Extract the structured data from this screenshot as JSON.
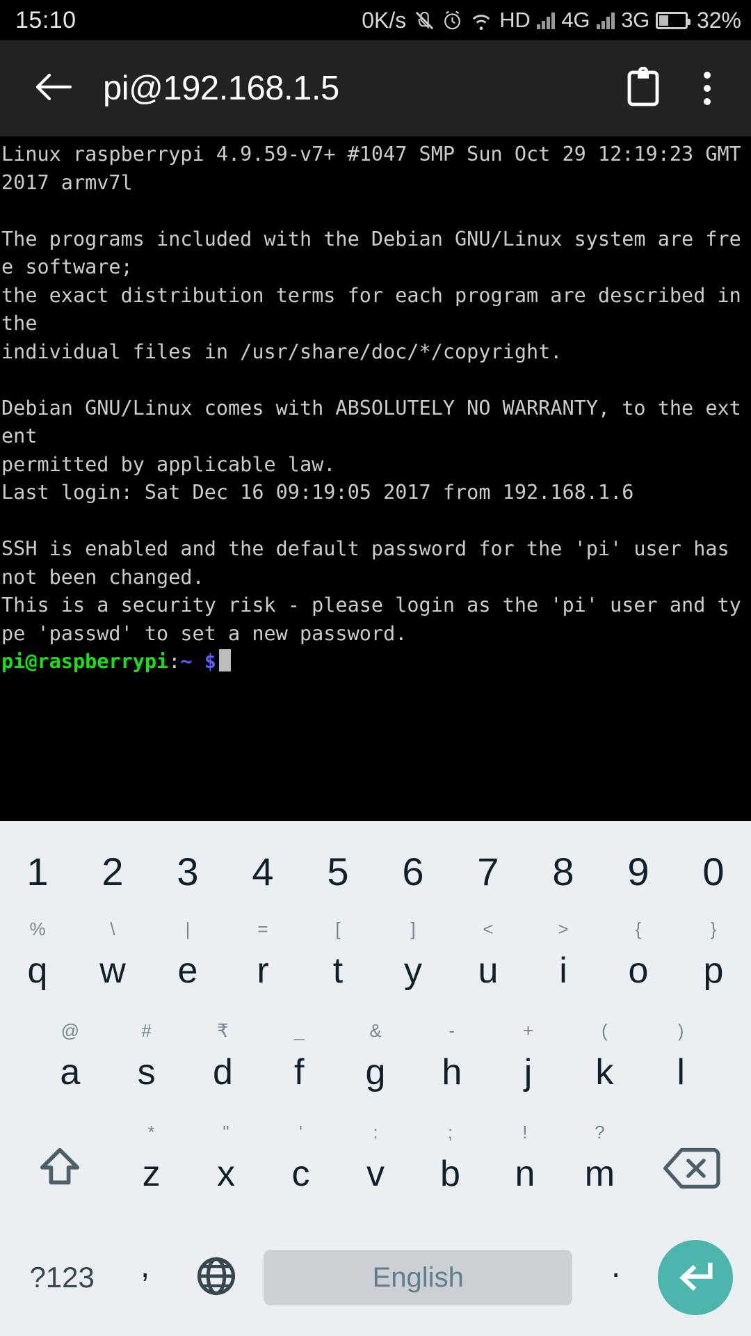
{
  "statusbar": {
    "clock": "15:10",
    "net_speed": "0K/s",
    "icons": [
      "mute-icon",
      "alarm-clock-icon",
      "wifi-icon"
    ],
    "hd_label": "HD",
    "sim1_label": "4G",
    "sim2_label": "3G",
    "battery_percent": "32%",
    "battery_level": 32
  },
  "appbar": {
    "back_icon": "back-arrow-icon",
    "title": "pi@192.168.1.5",
    "clipboard_icon": "clipboard-icon",
    "menu_icon": "overflow-menu-icon"
  },
  "terminal": {
    "output": "Linux raspberrypi 4.9.59-v7+ #1047 SMP Sun Oct 29 12:19:23 GMT 2017 armv7l\n\nThe programs included with the Debian GNU/Linux system are free software;\nthe exact distribution terms for each program are described in the\nindividual files in /usr/share/doc/*/copyright.\n\nDebian GNU/Linux comes with ABSOLUTELY NO WARRANTY, to the extent\npermitted by applicable law.\nLast login: Sat Dec 16 09:19:05 2017 from 192.168.1.6\n\nSSH is enabled and the default password for the 'pi' user has not been changed.\nThis is a security risk - please login as the 'pi' user and type 'passwd' to set a new password.\n",
    "prompt_user": "pi@raspberrypi",
    "prompt_colon": ":",
    "prompt_path": "~",
    "prompt_symbol": "$",
    "colors": {
      "background": "#000000",
      "foreground": "#cccccc",
      "prompt_user": "#18e018",
      "prompt_path": "#5c5cff"
    }
  },
  "keyboard": {
    "row1": [
      {
        "main": "1",
        "sub": ""
      },
      {
        "main": "2",
        "sub": ""
      },
      {
        "main": "3",
        "sub": ""
      },
      {
        "main": "4",
        "sub": ""
      },
      {
        "main": "5",
        "sub": ""
      },
      {
        "main": "6",
        "sub": ""
      },
      {
        "main": "7",
        "sub": ""
      },
      {
        "main": "8",
        "sub": ""
      },
      {
        "main": "9",
        "sub": ""
      },
      {
        "main": "0",
        "sub": ""
      }
    ],
    "row2": [
      {
        "main": "q",
        "sub": "%"
      },
      {
        "main": "w",
        "sub": "\\"
      },
      {
        "main": "e",
        "sub": "|"
      },
      {
        "main": "r",
        "sub": "="
      },
      {
        "main": "t",
        "sub": "["
      },
      {
        "main": "y",
        "sub": "]"
      },
      {
        "main": "u",
        "sub": "<"
      },
      {
        "main": "i",
        "sub": ">"
      },
      {
        "main": "o",
        "sub": "{"
      },
      {
        "main": "p",
        "sub": "}"
      }
    ],
    "row3": [
      {
        "main": "a",
        "sub": "@"
      },
      {
        "main": "s",
        "sub": "#"
      },
      {
        "main": "d",
        "sub": "₹"
      },
      {
        "main": "f",
        "sub": "_"
      },
      {
        "main": "g",
        "sub": "&"
      },
      {
        "main": "h",
        "sub": "-"
      },
      {
        "main": "j",
        "sub": "+"
      },
      {
        "main": "k",
        "sub": "("
      },
      {
        "main": "l",
        "sub": ")"
      }
    ],
    "row4": [
      {
        "main": "z",
        "sub": "*"
      },
      {
        "main": "x",
        "sub": "\""
      },
      {
        "main": "c",
        "sub": "'"
      },
      {
        "main": "v",
        "sub": ":"
      },
      {
        "main": "b",
        "sub": ";"
      },
      {
        "main": "n",
        "sub": "!"
      },
      {
        "main": "m",
        "sub": "?"
      }
    ],
    "shift_icon": "shift-arrow-icon",
    "backspace_icon": "backspace-icon",
    "symbols_label": "?123",
    "comma_label": ",",
    "globe_icon": "language-globe-icon",
    "space_label": "English",
    "period_label": ".",
    "enter_icon": "enter-return-icon",
    "colors": {
      "background": "#eceff1",
      "key_text": "#10202b",
      "sub_text": "#78868f",
      "spacebar": "#ccd0d4",
      "enter": "#4db6ac"
    }
  }
}
